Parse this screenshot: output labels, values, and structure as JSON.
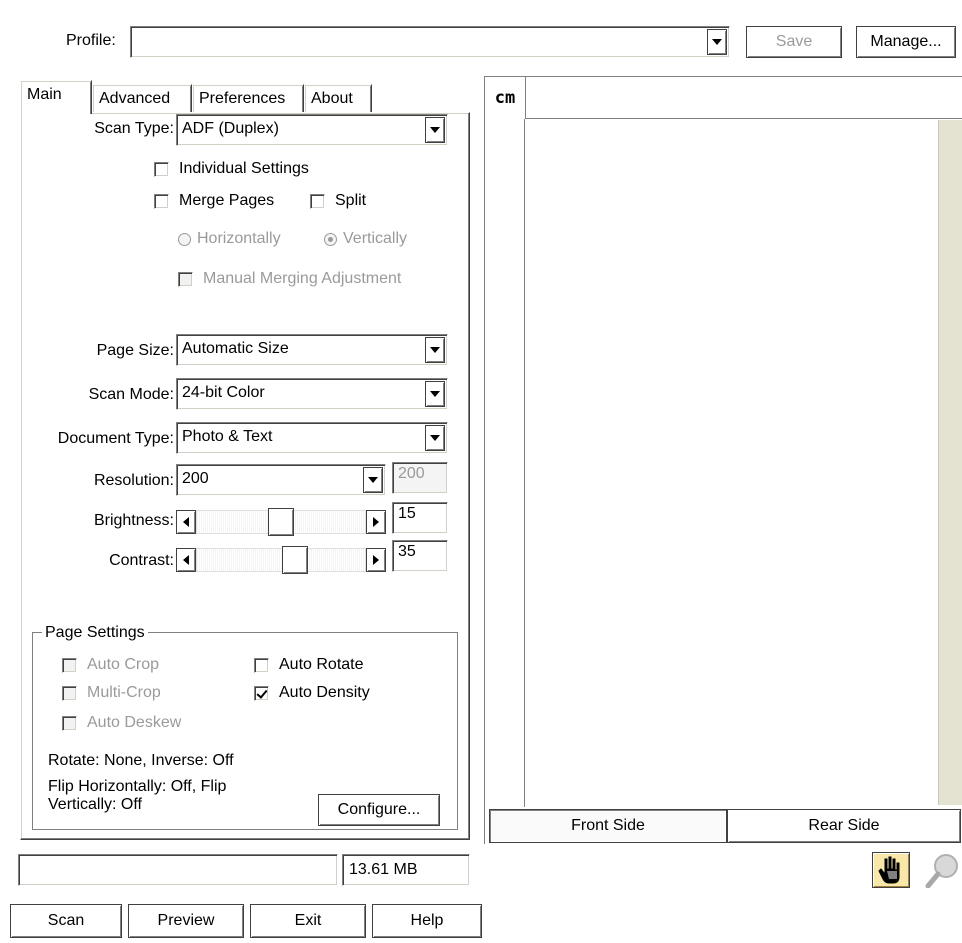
{
  "profile": {
    "label": "Profile:",
    "value": "",
    "save_label": "Save",
    "manage_label": "Manage..."
  },
  "tabs": [
    {
      "label": "Main",
      "active": true
    },
    {
      "label": "Advanced",
      "active": false
    },
    {
      "label": "Preferences",
      "active": false
    },
    {
      "label": "About",
      "active": false
    }
  ],
  "main": {
    "scan_type": {
      "label": "Scan Type:",
      "value": "ADF (Duplex)"
    },
    "individual_settings": {
      "label": "Individual Settings",
      "checked": false
    },
    "merge_pages": {
      "label": "Merge Pages",
      "checked": false
    },
    "split": {
      "label": "Split",
      "checked": false
    },
    "horizontally": {
      "label": "Horizontally",
      "selected": false
    },
    "vertically": {
      "label": "Vertically",
      "selected": true
    },
    "manual_merging": {
      "label": "Manual Merging Adjustment",
      "checked": false
    },
    "page_size": {
      "label": "Page Size:",
      "value": "Automatic Size"
    },
    "scan_mode": {
      "label": "Scan Mode:",
      "value": "24-bit Color"
    },
    "document_type": {
      "label": "Document Type:",
      "value": "Photo & Text"
    },
    "resolution": {
      "label": "Resolution:",
      "value": "200",
      "custom_value": "200"
    },
    "brightness": {
      "label": "Brightness:",
      "value": "15",
      "level": 0.5
    },
    "contrast": {
      "label": "Contrast:",
      "value": "35",
      "level": 0.6
    }
  },
  "page_settings": {
    "title": "Page Settings",
    "auto_crop": {
      "label": "Auto Crop",
      "checked": false
    },
    "multi_crop": {
      "label": "Multi-Crop",
      "checked": false
    },
    "auto_deskew": {
      "label": "Auto Deskew",
      "checked": false
    },
    "auto_rotate": {
      "label": "Auto Rotate",
      "checked": false
    },
    "auto_density": {
      "label": "Auto Density",
      "checked": true
    },
    "rotate_info": "Rotate: None, Inverse: Off",
    "flip_info_line1": "Flip Horizontally: Off, Flip",
    "flip_info_line2": "Vertically: Off",
    "configure_label": "Configure..."
  },
  "status": {
    "progress_text": "",
    "memory": "13.61 MB"
  },
  "buttons": {
    "scan": "Scan",
    "preview": "Preview",
    "exit": "Exit",
    "help": "Help"
  },
  "preview": {
    "ruler_unit": "cm",
    "front_side": "Front Side",
    "rear_side": "Rear Side"
  },
  "icons": {
    "hand_tool": "hand-pointer-icon",
    "zoom_tool": "zoom-icon"
  }
}
